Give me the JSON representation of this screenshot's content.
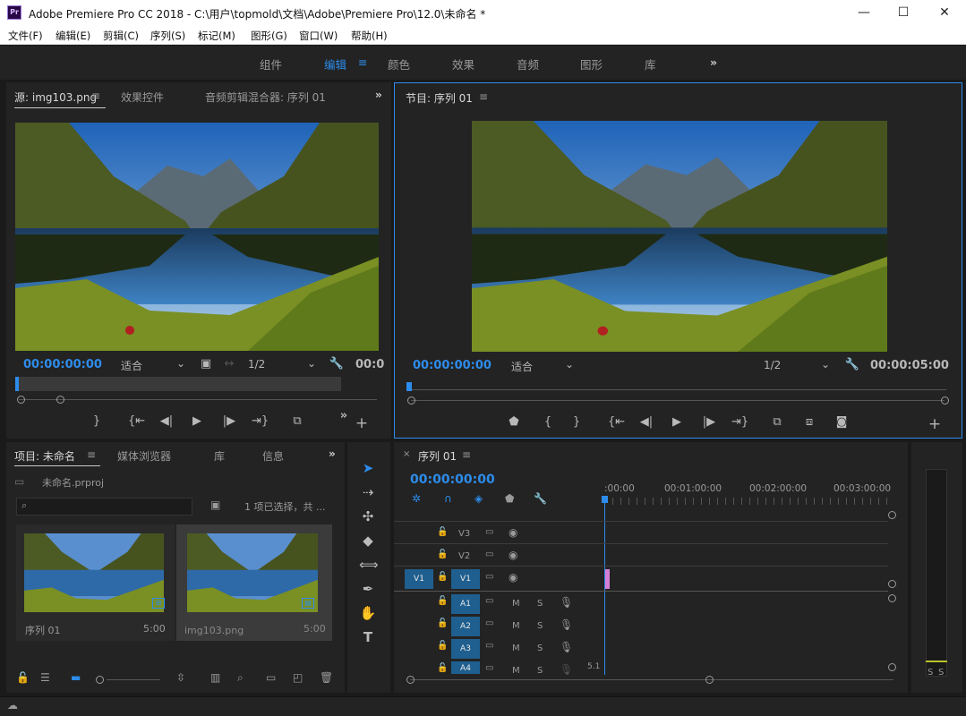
{
  "window": {
    "title": "Adobe Premiere Pro CC 2018 - C:\\用户\\topmold\\文档\\Adobe\\Premiere Pro\\12.0\\未命名 *",
    "icon_label": "Pr",
    "minimize_glyph": "—",
    "maximize_glyph": "☐",
    "close_glyph": "✕"
  },
  "menu": [
    "文件(F)",
    "编辑(E)",
    "剪辑(C)",
    "序列(S)",
    "标记(M)",
    "图形(G)",
    "窗口(W)",
    "帮助(H)"
  ],
  "workspaces": {
    "items": [
      "组件",
      "编辑",
      "颜色",
      "效果",
      "音频",
      "图形",
      "库"
    ],
    "active": "编辑",
    "overflow": "»"
  },
  "source_panel": {
    "tabs": [
      "源: img103.png",
      "效果控件",
      "音频剪辑混合器: 序列 01"
    ],
    "timecode": "00:00:00:00",
    "fit": "适合",
    "resolution": "1/2",
    "end_timecode": "00:0",
    "overflow": "»"
  },
  "program_panel": {
    "tab": "节目: 序列 01",
    "timecode": "00:00:00:00",
    "fit": "适合",
    "resolution": "1/2",
    "duration": "00:00:05:00"
  },
  "project_panel": {
    "tabs": [
      "项目: 未命名",
      "媒体浏览器",
      "库",
      "信息"
    ],
    "project_file": "未命名.prproj",
    "search_placeholder": "",
    "selection_info": "1 项已选择，共 ...",
    "items": [
      {
        "name": "序列 01",
        "duration": "5:00",
        "badge": "sequence-icon"
      },
      {
        "name": "img103.png",
        "duration": "5:00",
        "badge": "still-image-icon"
      }
    ],
    "overflow": "»"
  },
  "timeline": {
    "tab": "序列 01",
    "timecode": "00:00:00:00",
    "ruler": [
      ":00:00",
      "00:01:00:00",
      "00:02:00:00",
      "00:03:00:00"
    ],
    "video_tracks": [
      "V3",
      "V2",
      "V1"
    ],
    "audio_tracks": [
      "A1",
      "A2",
      "A3",
      "A4"
    ],
    "source_patch": "V1",
    "mute_label": "M",
    "solo_label": "S",
    "a4_level": "5.1"
  },
  "audio_meter": {
    "solo_left": "S",
    "solo_right": "S"
  },
  "colors": {
    "accent": "#2d8ceb",
    "panel": "#232323",
    "track_blue": "#1f5f8f",
    "clip_pink": "#d67fd6"
  }
}
